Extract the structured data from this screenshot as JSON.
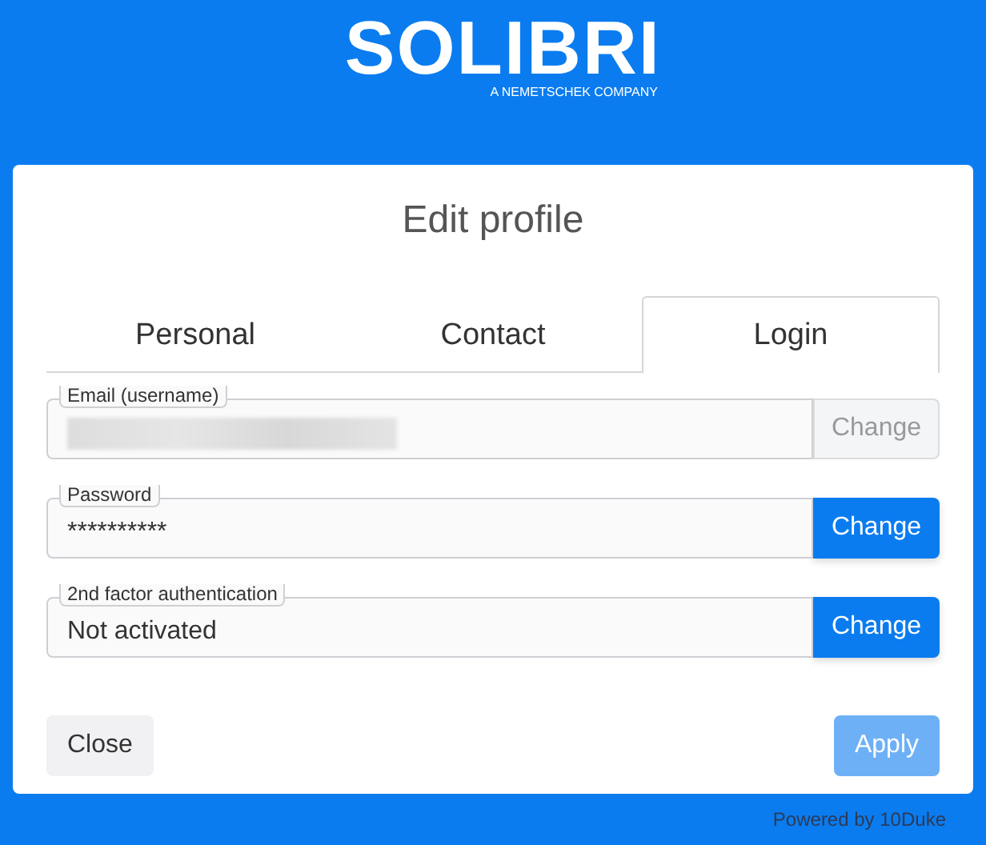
{
  "logo": {
    "name": "SOLIBRI",
    "tagline": "A NEMETSCHEK COMPANY"
  },
  "title": "Edit profile",
  "tabs": [
    {
      "label": "Personal",
      "selected": false
    },
    {
      "label": "Contact",
      "selected": false
    },
    {
      "label": "Login",
      "selected": true
    }
  ],
  "fields": [
    {
      "label": "Email (username)",
      "redacted": true,
      "button": {
        "label": "Change",
        "disabled": true
      }
    },
    {
      "label": "Password",
      "value": "**********",
      "button": {
        "label": "Change",
        "disabled": false
      }
    },
    {
      "label": "2nd factor authentication",
      "value": "Not activated",
      "button": {
        "label": "Change",
        "disabled": false
      }
    }
  ],
  "buttons": [
    {
      "label": "Close",
      "kind": "secondary",
      "disabled": false
    },
    {
      "label": "Apply",
      "kind": "primary",
      "disabled": true
    }
  ],
  "footer": "Powered by 10Duke"
}
